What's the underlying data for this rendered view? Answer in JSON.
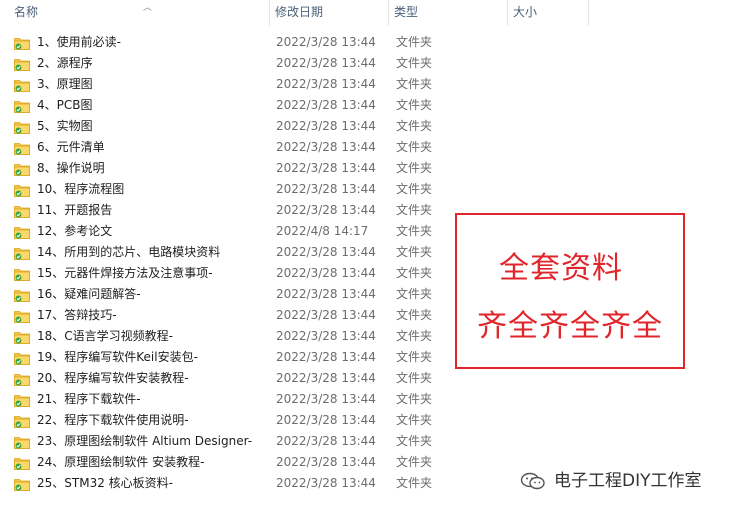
{
  "columns": {
    "name": "名称",
    "modified": "修改日期",
    "type": "类型",
    "size": "大小"
  },
  "files": [
    {
      "name": "1、使用前必读-",
      "modified": "2022/3/28 13:44",
      "type": "文件夹"
    },
    {
      "name": "2、源程序",
      "modified": "2022/3/28 13:44",
      "type": "文件夹"
    },
    {
      "name": "3、原理图",
      "modified": "2022/3/28 13:44",
      "type": "文件夹"
    },
    {
      "name": "4、PCB图",
      "modified": "2022/3/28 13:44",
      "type": "文件夹"
    },
    {
      "name": "5、实物图",
      "modified": "2022/3/28 13:44",
      "type": "文件夹"
    },
    {
      "name": "6、元件清单",
      "modified": "2022/3/28 13:44",
      "type": "文件夹"
    },
    {
      "name": "8、操作说明",
      "modified": "2022/3/28 13:44",
      "type": "文件夹"
    },
    {
      "name": "10、程序流程图",
      "modified": "2022/3/28 13:44",
      "type": "文件夹"
    },
    {
      "name": "11、开题报告",
      "modified": "2022/3/28 13:44",
      "type": "文件夹"
    },
    {
      "name": "12、参考论文",
      "modified": "2022/4/8 14:17",
      "type": "文件夹"
    },
    {
      "name": "14、所用到的芯片、电路模块资料",
      "modified": "2022/3/28 13:44",
      "type": "文件夹"
    },
    {
      "name": "15、元器件焊接方法及注意事项-",
      "modified": "2022/3/28 13:44",
      "type": "文件夹"
    },
    {
      "name": "16、疑难问题解答-",
      "modified": "2022/3/28 13:44",
      "type": "文件夹"
    },
    {
      "name": "17、答辩技巧-",
      "modified": "2022/3/28 13:44",
      "type": "文件夹"
    },
    {
      "name": "18、C语言学习视频教程-",
      "modified": "2022/3/28 13:44",
      "type": "文件夹"
    },
    {
      "name": "19、程序编写软件Keil安装包-",
      "modified": "2022/3/28 13:44",
      "type": "文件夹"
    },
    {
      "name": "20、程序编写软件安装教程-",
      "modified": "2022/3/28 13:44",
      "type": "文件夹"
    },
    {
      "name": "21、程序下载软件-",
      "modified": "2022/3/28 13:44",
      "type": "文件夹"
    },
    {
      "name": "22、程序下载软件使用说明-",
      "modified": "2022/3/28 13:44",
      "type": "文件夹"
    },
    {
      "name": "23、原理图绘制软件 Altium Designer-",
      "modified": "2022/3/28 13:44",
      "type": "文件夹"
    },
    {
      "name": "24、原理图绘制软件 安装教程-",
      "modified": "2022/3/28 13:44",
      "type": "文件夹"
    },
    {
      "name": "25、STM32 核心板资料-",
      "modified": "2022/3/28 13:44",
      "type": "文件夹"
    }
  ],
  "promo": {
    "line1": "全套资料",
    "line2": "齐全齐全齐全"
  },
  "watermark": {
    "text": "电子工程DIY工作室",
    "icon": "wechat-icon"
  },
  "colors": {
    "accent_red": "#e0262b",
    "header_text": "#4c607a",
    "folder_yellow": "#f5c54a",
    "sync_green": "#3ba43b"
  }
}
